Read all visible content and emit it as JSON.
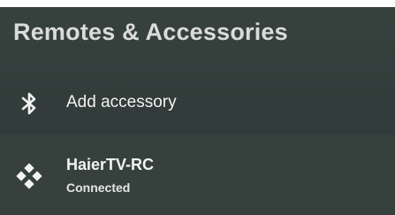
{
  "header": {
    "title": "Remotes & Accessories"
  },
  "items": [
    {
      "label": "Add accessory",
      "icon": "bluetooth-icon"
    },
    {
      "label": "HaierTV-RC",
      "status": "Connected",
      "icon": "gamepad-icon"
    }
  ],
  "colors": {
    "background": "#333d3b",
    "selected_row": "#36413e",
    "title_text": "#d9dcdb",
    "item_text": "#f2f3f3"
  }
}
